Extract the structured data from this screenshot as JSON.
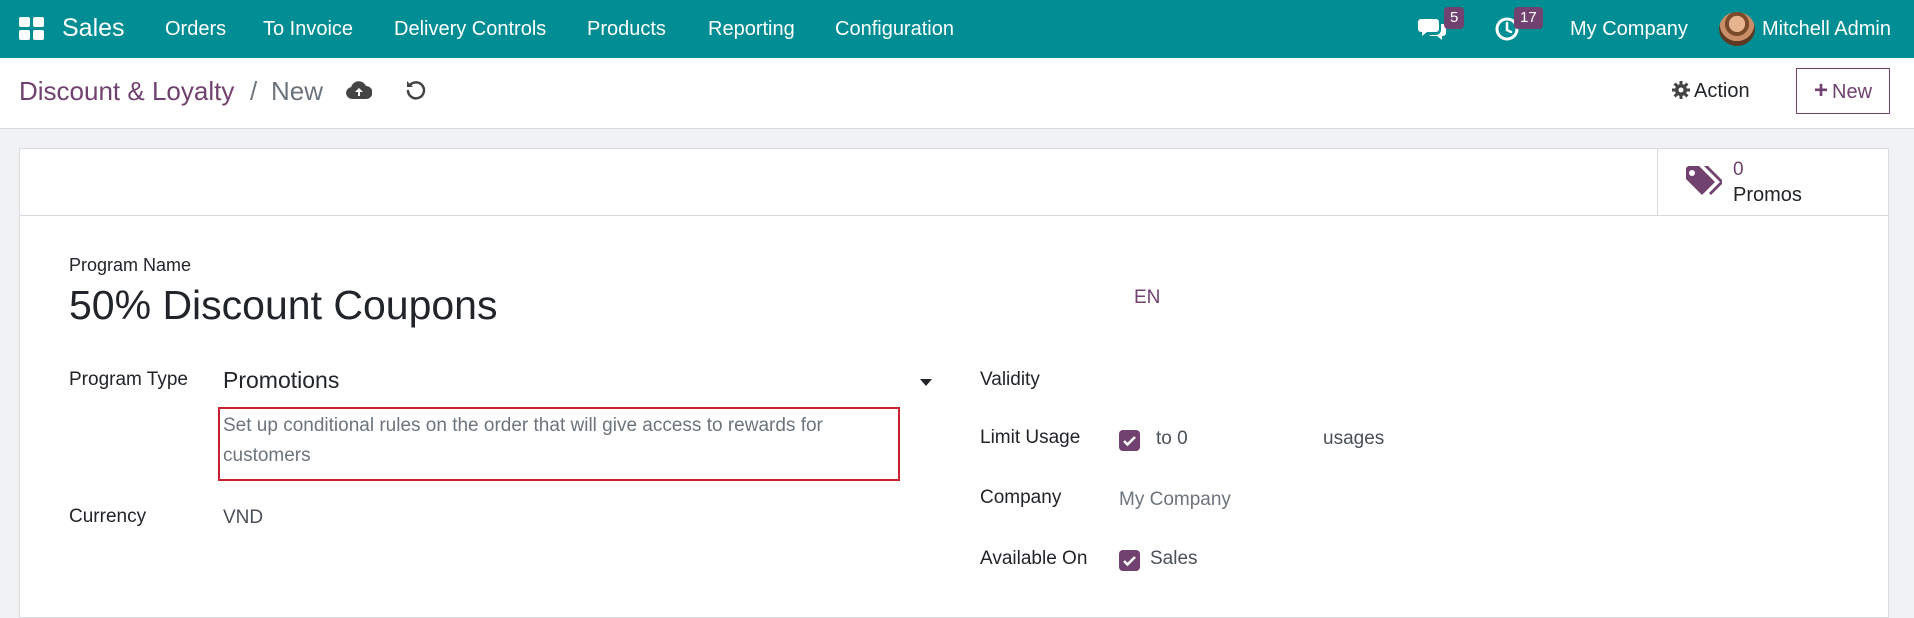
{
  "app": {
    "name": "Sales"
  },
  "nav": {
    "items": [
      {
        "label": "Orders"
      },
      {
        "label": "To Invoice"
      },
      {
        "label": "Delivery Controls"
      },
      {
        "label": "Products"
      },
      {
        "label": "Reporting"
      },
      {
        "label": "Configuration"
      }
    ],
    "messages_count": "5",
    "activities_count": "17",
    "company": "My Company",
    "user": "Mitchell Admin"
  },
  "breadcrumb": {
    "root": "Discount & Loyalty",
    "separator": "/",
    "current": "New"
  },
  "control": {
    "action_label": "Action",
    "new_label": "New"
  },
  "stat": {
    "count": "0",
    "label": "Promos"
  },
  "form": {
    "program_name_label": "Program Name",
    "program_name": "50% Discount Coupons",
    "lang": "EN",
    "program_type_label": "Program Type",
    "program_type": "Promotions",
    "program_type_help": "Set up conditional rules on the order that will give access to rewards for customers",
    "currency_label": "Currency",
    "currency": "VND",
    "validity_label": "Validity",
    "limit_usage_label": "Limit Usage",
    "limit_usage_checked": true,
    "limit_to": "to 0",
    "usages_label": "usages",
    "company_label": "Company",
    "company": "My Company",
    "available_on_label": "Available On",
    "available_on_sales_checked": true,
    "available_on_sales": "Sales"
  },
  "colors": {
    "navbar": "#018d94",
    "accent": "#71426f",
    "highlight": "#c8202f"
  }
}
